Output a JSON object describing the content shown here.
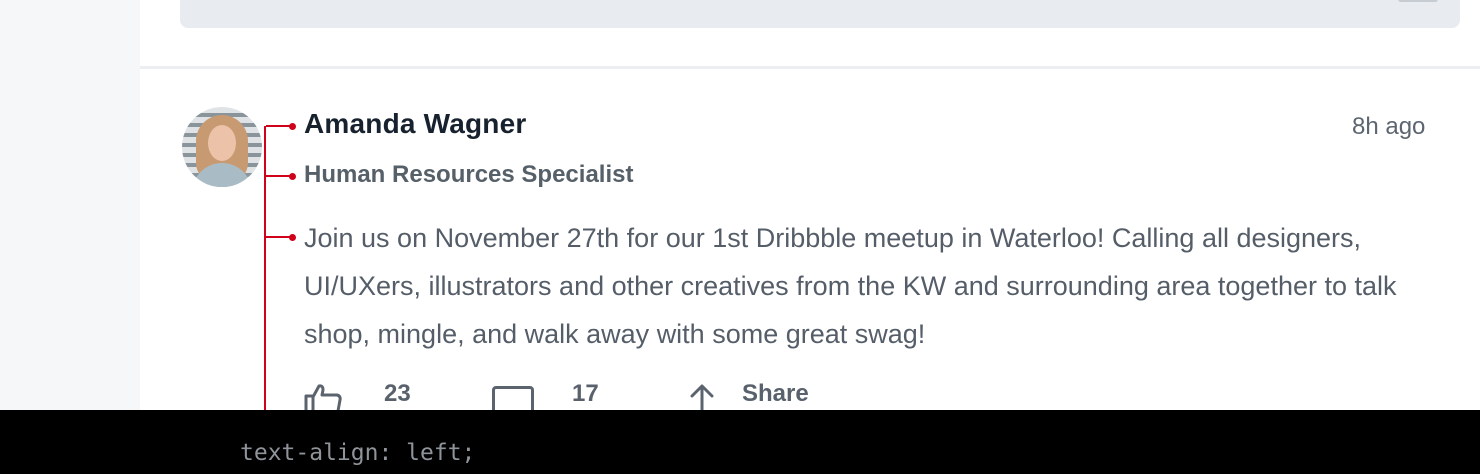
{
  "post": {
    "author_name": "Amanda Wagner",
    "author_title": "Human Resources Specialist",
    "timestamp": "8h ago",
    "body": "Join us on November 27th for our 1st Dribbble meetup in Waterloo! Calling all designers, UI/UXers, illustrators and other creatives from the KW and surrounding area together to talk shop, mingle, and walk away with some great swag!",
    "likes": "23",
    "comments": "17",
    "share_label": "Share"
  },
  "annotation": {
    "caption": "text-align: left;",
    "color": "#d0021b"
  },
  "icons": {
    "like": "thumbs-up-icon",
    "comment": "comment-icon",
    "share": "share-arrow-icon"
  }
}
